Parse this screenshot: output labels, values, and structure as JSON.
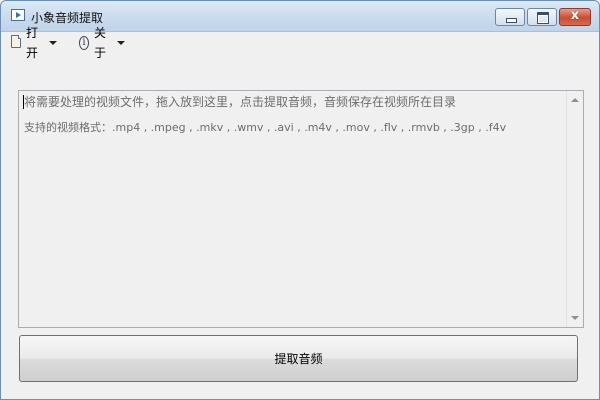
{
  "window": {
    "title": "小象音频提取",
    "app_icon": "app-icon",
    "controls": {
      "minimize": "minimize-icon",
      "maximize": "maximize-icon",
      "close": "close-icon",
      "close_glyph": "x"
    }
  },
  "menu": {
    "open": {
      "label": "打开",
      "icon": "folder-open-icon"
    },
    "about": {
      "label": "关于",
      "icon": "info-icon",
      "icon_glyph": "i"
    }
  },
  "drop_area": {
    "hint": "将需要处理的视频文件，拖入放到这里，点击提取音频，音频保存在视频所在目录",
    "formats": "支持的视频格式：.mp4 , .mpeg , .mkv , .wmv , .avi , .m4v , .mov , .flv , .rmvb , .3gp , .f4v"
  },
  "actions": {
    "extract_label": "提取音频"
  },
  "colors": {
    "titlebar": "#c9dbee",
    "close_button": "#c84e33",
    "hint_text": "#6d6d6d"
  }
}
